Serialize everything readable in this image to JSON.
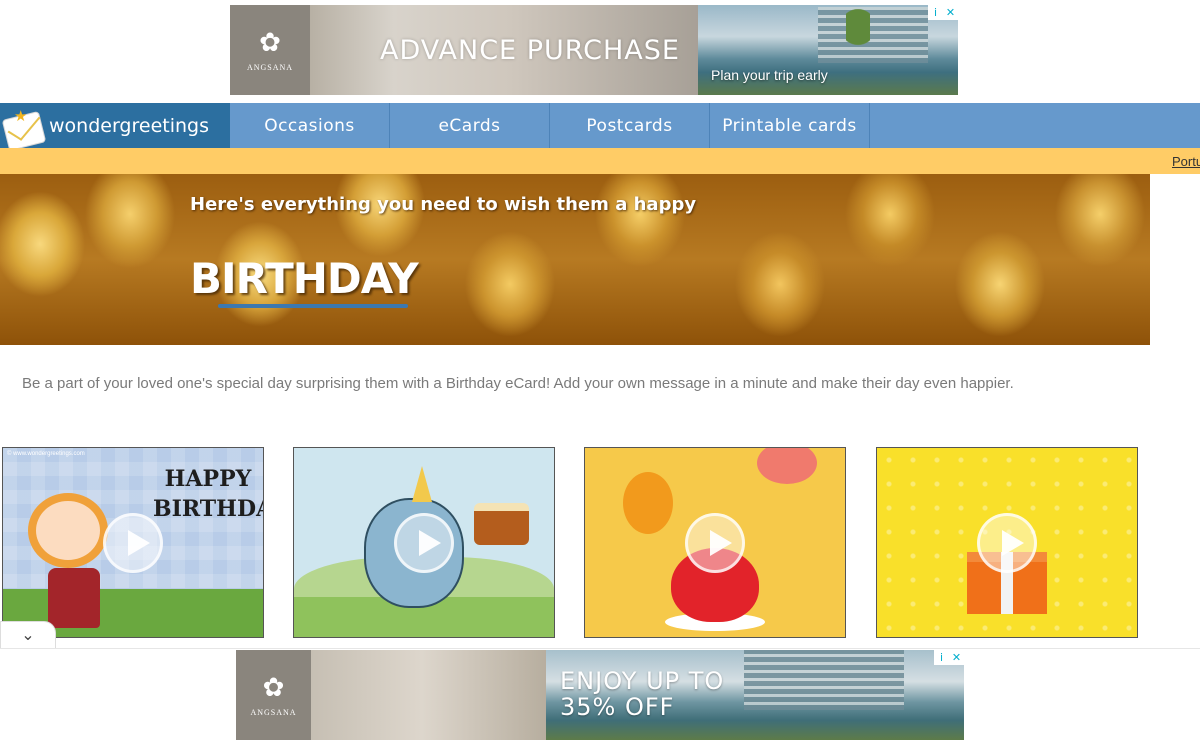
{
  "top_ad": {
    "brand": "ANGSANA",
    "headline": "ADVANCE PURCHASE",
    "cta": "Plan your trip early",
    "info_icon": "i",
    "close_icon": "✕"
  },
  "nav": {
    "logo_text": "wondergreetings",
    "items": [
      {
        "label": "Occasions"
      },
      {
        "label": "eCards"
      },
      {
        "label": "Postcards"
      },
      {
        "label": "Printable cards"
      }
    ]
  },
  "lang_link": "Português",
  "banner": {
    "subtitle": "Here's everything you need to wish them a happy",
    "title": "BIRTHDAY"
  },
  "intro": "Be a part of your loved one's special day surprising them with a Birthday eCard! Add your own message in a minute and make their day even happier.",
  "cards": [
    {
      "art_text": "HAPPY BIRTHDAY!",
      "copyright": "© www.wondergreetings.com"
    },
    {
      "art_text": ""
    },
    {
      "art_text": ""
    },
    {
      "art_text": ""
    }
  ],
  "collapse_icon": "⌄",
  "bottom_ad": {
    "brand": "ANGSANA",
    "headline_line1": "ENJOY UP TO",
    "headline_line2": "35% OFF",
    "info_icon": "i",
    "close_icon": "✕"
  },
  "colors": {
    "nav_bg": "#6699cc",
    "logo_bg": "#2c6fa0",
    "strip_bg": "#ffcc66",
    "text_gray": "#7a7a7a"
  }
}
